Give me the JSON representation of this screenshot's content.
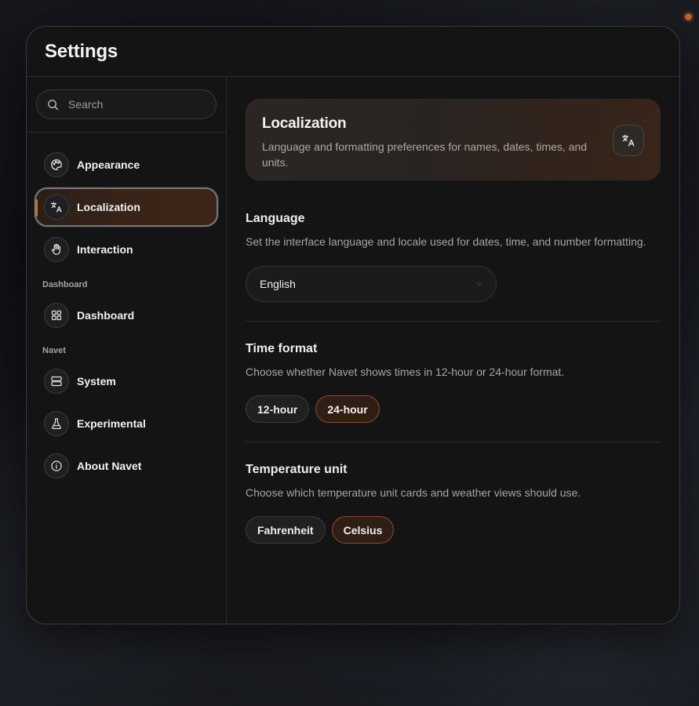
{
  "window": {
    "title": "Settings"
  },
  "search": {
    "placeholder": "Search"
  },
  "sidebar": {
    "items": [
      {
        "label": "Appearance",
        "icon": "palette-icon",
        "active": false
      },
      {
        "label": "Localization",
        "icon": "translate-icon",
        "active": true
      },
      {
        "label": "Interaction",
        "icon": "hand-icon",
        "active": false
      }
    ],
    "groups": [
      {
        "heading": "Dashboard",
        "items": [
          {
            "label": "Dashboard",
            "icon": "grid-icon"
          }
        ]
      },
      {
        "heading": "Navet",
        "items": [
          {
            "label": "System",
            "icon": "server-icon"
          },
          {
            "label": "Experimental",
            "icon": "flask-icon"
          },
          {
            "label": "About Navet",
            "icon": "info-icon"
          }
        ]
      }
    ]
  },
  "hero": {
    "title": "Localization",
    "description": "Language and formatting preferences for names, dates, times, and units.",
    "icon": "translate-icon"
  },
  "sections": {
    "language": {
      "title": "Language",
      "description": "Set the interface language and locale used for dates, time, and number formatting.",
      "selected": "English"
    },
    "time_format": {
      "title": "Time format",
      "description": "Choose whether Navet shows times in 12-hour or 24-hour format.",
      "options": [
        "12-hour",
        "24-hour"
      ],
      "selected": "24-hour"
    },
    "temperature": {
      "title": "Temperature unit",
      "description": "Choose which temperature unit cards and weather views should use.",
      "options": [
        "Fahrenheit",
        "Celsius"
      ],
      "selected": "Celsius"
    }
  },
  "colors": {
    "accent": "#c97333",
    "background": "#141415",
    "status_dot": "#c4632a"
  }
}
